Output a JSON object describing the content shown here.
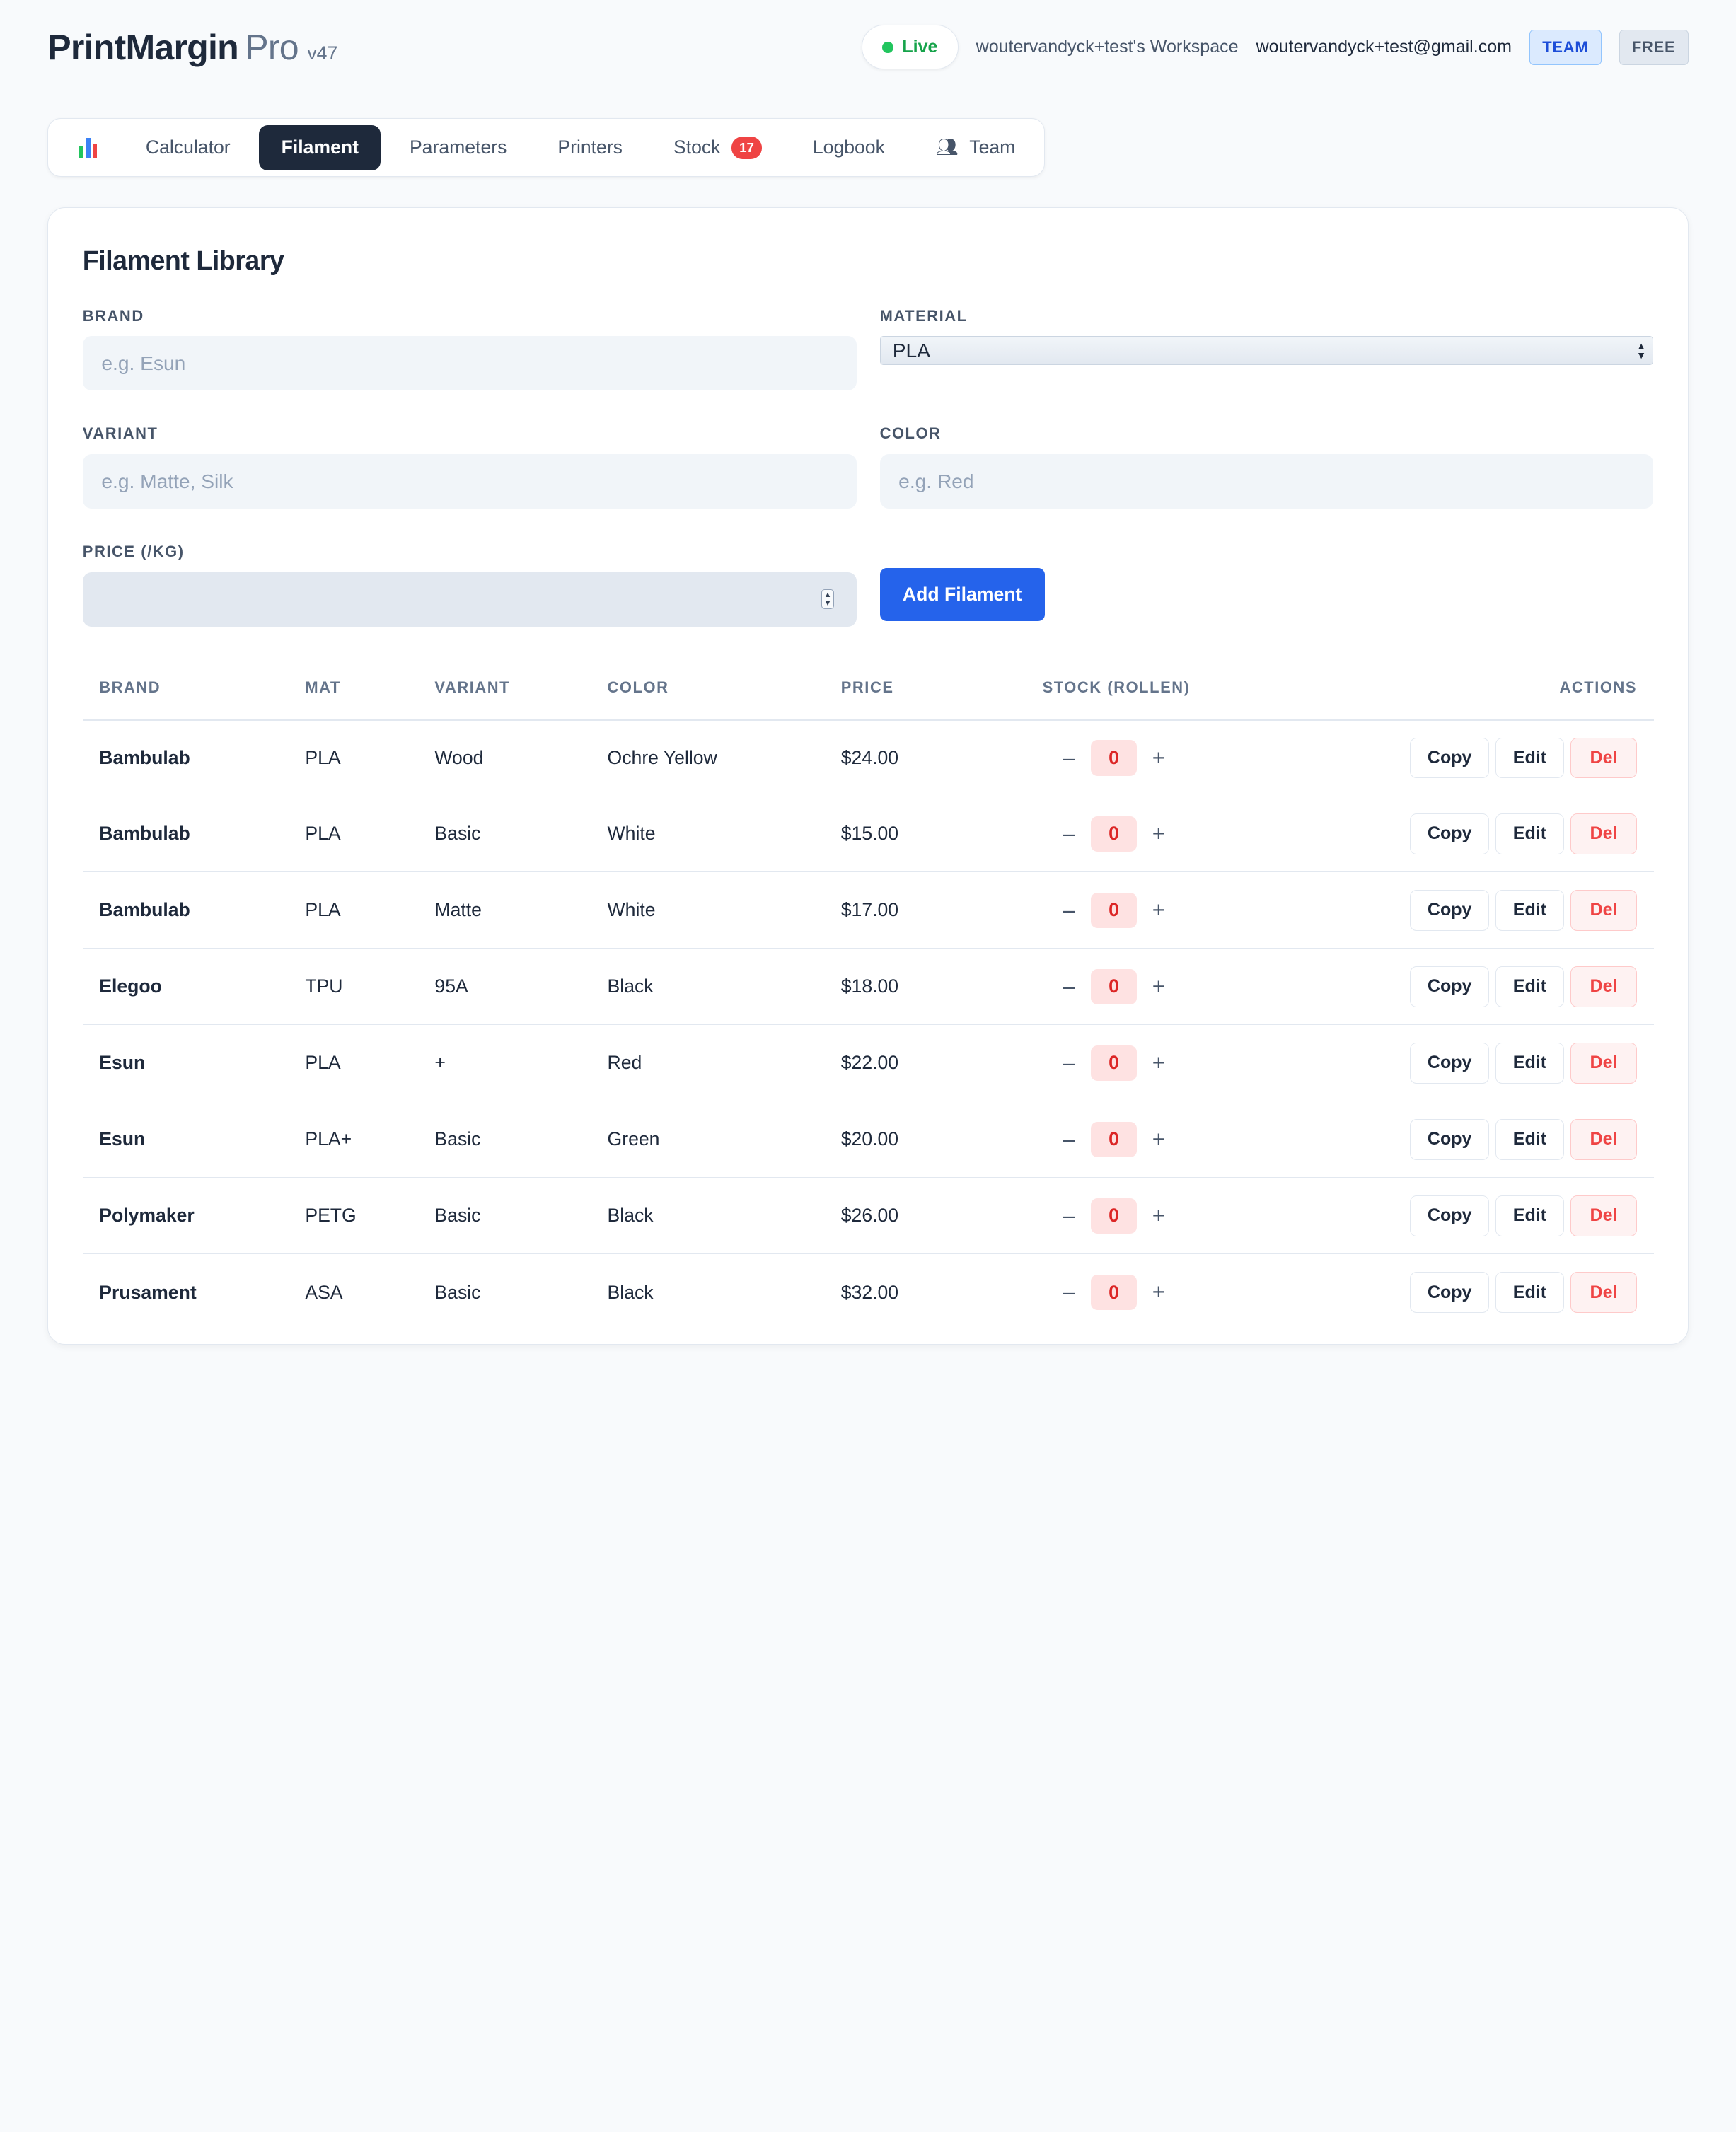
{
  "header": {
    "brand_name": "PrintMargin",
    "brand_pro": "Pro",
    "version": "v47",
    "live_label": "Live",
    "workspace": "woutervandyck+test's Workspace",
    "email": "woutervandyck+test@gmail.com",
    "tag_team": "TEAM",
    "tag_free": "FREE"
  },
  "nav": {
    "tabs": [
      {
        "label": "Calculator"
      },
      {
        "label": "Filament"
      },
      {
        "label": "Parameters"
      },
      {
        "label": "Printers"
      },
      {
        "label": "Stock",
        "badge": "17"
      },
      {
        "label": "Logbook"
      },
      {
        "label": "Team"
      }
    ],
    "active": "Filament"
  },
  "library": {
    "title": "Filament Library",
    "brand_label": "BRAND",
    "brand_placeholder": "e.g. Esun",
    "material_label": "MATERIAL",
    "material_value": "PLA",
    "variant_label": "VARIANT",
    "variant_placeholder": "e.g. Matte, Silk",
    "color_label": "COLOR",
    "color_placeholder": "e.g. Red",
    "price_label": "PRICE (/KG)",
    "add_button": "Add Filament"
  },
  "table": {
    "headers": {
      "brand": "BRAND",
      "mat": "MAT",
      "variant": "VARIANT",
      "color": "COLOR",
      "price": "PRICE",
      "stock": "STOCK (ROLLEN)",
      "actions": "ACTIONS"
    },
    "rows": [
      {
        "brand": "Bambulab",
        "mat": "PLA",
        "variant": "Wood",
        "color": "Ochre Yellow",
        "price": "$24.00",
        "stock": "0"
      },
      {
        "brand": "Bambulab",
        "mat": "PLA",
        "variant": "Basic",
        "color": "White",
        "price": "$15.00",
        "stock": "0"
      },
      {
        "brand": "Bambulab",
        "mat": "PLA",
        "variant": "Matte",
        "color": "White",
        "price": "$17.00",
        "stock": "0"
      },
      {
        "brand": "Elegoo",
        "mat": "TPU",
        "variant": "95A",
        "color": "Black",
        "price": "$18.00",
        "stock": "0"
      },
      {
        "brand": "Esun",
        "mat": "PLA",
        "variant": "+",
        "color": "Red",
        "price": "$22.00",
        "stock": "0"
      },
      {
        "brand": "Esun",
        "mat": "PLA+",
        "variant": "Basic",
        "color": "Green",
        "price": "$20.00",
        "stock": "0"
      },
      {
        "brand": "Polymaker",
        "mat": "PETG",
        "variant": "Basic",
        "color": "Black",
        "price": "$26.00",
        "stock": "0"
      },
      {
        "brand": "Prusament",
        "mat": "ASA",
        "variant": "Basic",
        "color": "Black",
        "price": "$32.00",
        "stock": "0"
      }
    ],
    "actions": {
      "copy": "Copy",
      "edit": "Edit",
      "del": "Del",
      "minus": "–",
      "plus": "+"
    }
  }
}
